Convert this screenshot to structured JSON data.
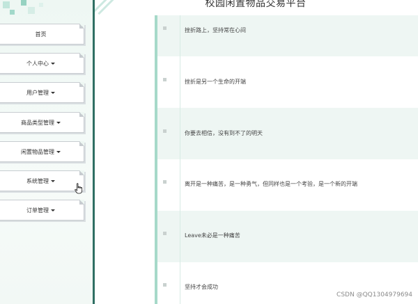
{
  "header": {
    "title": "校园闲置物品交易平台"
  },
  "sidebar": {
    "items": [
      {
        "label": "首页",
        "has_caret": false
      },
      {
        "label": "个人中心",
        "has_caret": true
      },
      {
        "label": "用户管理",
        "has_caret": true
      },
      {
        "label": "商品类型管理",
        "has_caret": true
      },
      {
        "label": "闲置物品管理",
        "has_caret": true
      },
      {
        "label": "系统管理",
        "has_caret": true
      },
      {
        "label": "订单管理",
        "has_caret": true
      }
    ]
  },
  "content": {
    "rows": [
      {
        "text": "挫折路上，坚持常在心间",
        "shaded": true
      },
      {
        "text": "挫折是另一个生命的开端",
        "shaded": false
      },
      {
        "text": "你要去相信，没有到不了的明天",
        "shaded": true
      },
      {
        "text": "离开是一种痛苦，是一种勇气，但同样也是一个考验，是一个新的开端",
        "shaded": false
      },
      {
        "text": "Leave未必是一种痛苦",
        "shaded": true
      },
      {
        "text": "坚持才会成功",
        "shaded": false
      }
    ]
  },
  "watermark": {
    "text": "CSDN @QQ1304979694"
  },
  "colors": {
    "sidebar_border": "#2f6f63",
    "accent_light": "#a6d9c9",
    "row_shade": "#eef6f3"
  },
  "icons": {
    "menu_caret": "caret-down-icon",
    "row_bullet": "square-bullet-icon",
    "cursor": "hand-pointer-icon"
  }
}
